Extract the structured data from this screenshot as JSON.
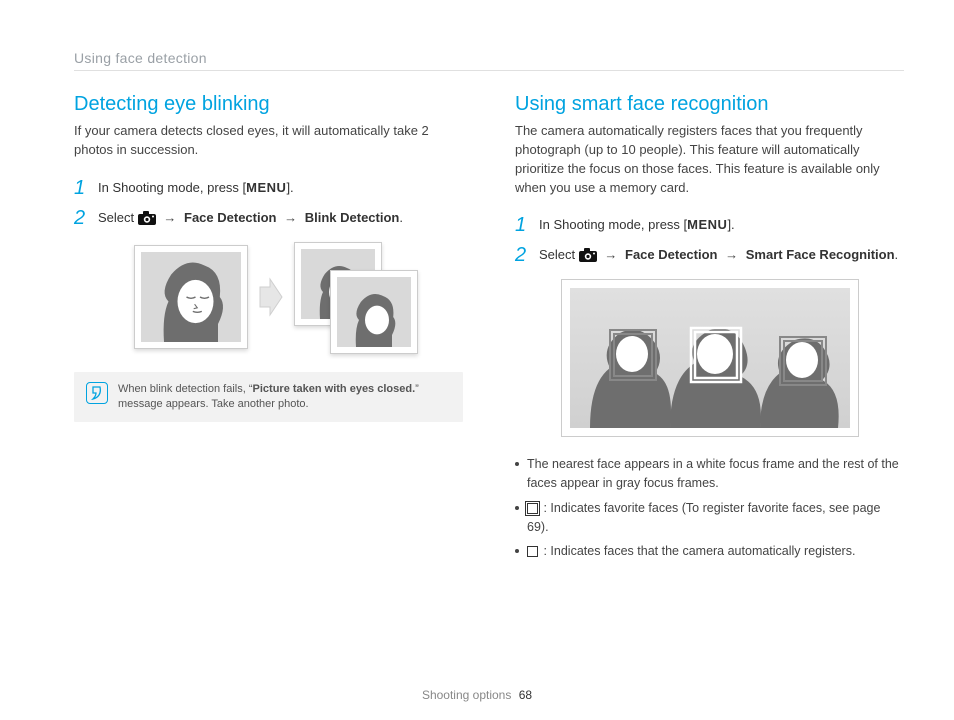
{
  "header": {
    "breadcrumb": "Using face detection"
  },
  "left": {
    "title": "Detecting eye blinking",
    "intro": "If your camera detects closed eyes, it will automatically take 2 photos in succession.",
    "step1_text": "In Shooting mode, press [",
    "step1_menu": "MENU",
    "step1_close": "].",
    "step2_select": "Select ",
    "step2_path1": "Face Detection",
    "step2_path2": "Blink Detection",
    "note_prefix": "When blink detection fails, “",
    "note_bold": "Picture taken with eyes closed.",
    "note_suffix": "” message appears. Take another photo."
  },
  "right": {
    "title": "Using smart face recognition",
    "intro": "The camera automatically registers faces that you frequently photograph (up to 10 people). This feature will automatically prioritize the focus on those faces. This feature is available only when you use a memory card.",
    "step1_text": "In Shooting mode, press [",
    "step1_menu": "MENU",
    "step1_close": "].",
    "step2_select": "Select ",
    "step2_path1": "Face Detection",
    "step2_path2": "Smart Face Recognition",
    "bullet1": "The nearest face appears in a white focus frame and the rest of the faces appear in gray focus frames.",
    "bullet2": ": Indicates favorite faces (To register favorite faces, see page 69).",
    "bullet3": ": Indicates faces that the camera automatically registers."
  },
  "footer": {
    "section": "Shooting options",
    "page": "68"
  },
  "symbols": {
    "arrow": "→"
  }
}
